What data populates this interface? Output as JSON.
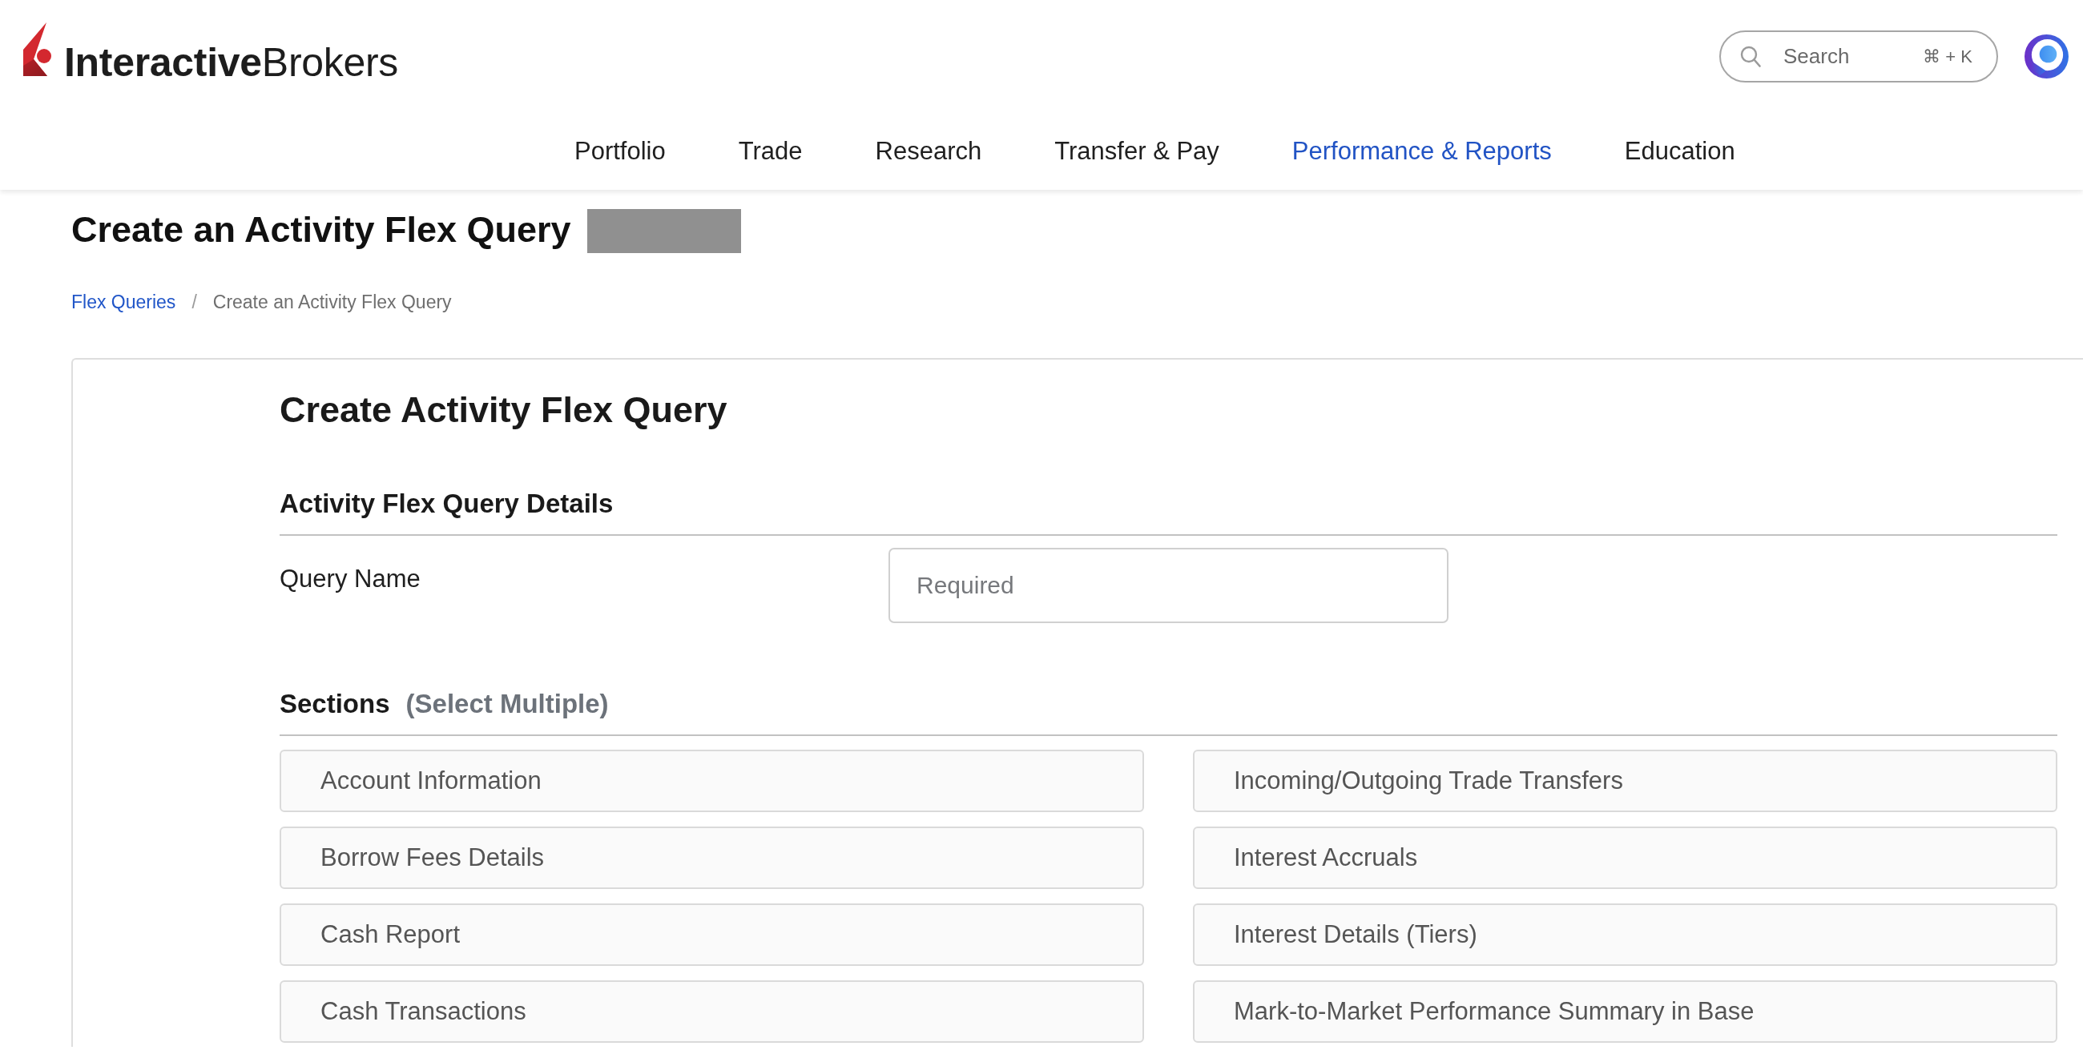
{
  "header": {
    "logo": "**Interactive**Brokers",
    "search": {
      "placeholder": "Search",
      "shortcut": "⌘ + K"
    }
  },
  "nav": [
    {
      "label": "Portfolio",
      "selected": false
    },
    {
      "label": "Trade",
      "selected": false
    },
    {
      "label": "Research",
      "selected": false
    },
    {
      "label": "Transfer & Pay",
      "selected": false
    },
    {
      "label": "Performance & Reports",
      "selected": true
    },
    {
      "label": "Education",
      "selected": false
    }
  ],
  "page": {
    "title": "Create an Activity Flex Query",
    "breadcrumb": {
      "separator": "/",
      "items": [
        {
          "label": "Flex Queries",
          "kind": "link"
        },
        {
          "label": "Create an Activity Flex Query",
          "kind": "current"
        }
      ]
    }
  },
  "form": {
    "title": "Create Activity Flex Query",
    "details": {
      "heading": "Activity Flex Query Details",
      "fields": [
        {
          "label": "Query Name",
          "placeholder": "Required"
        }
      ]
    },
    "sections": {
      "heading": "Sections",
      "hint": "(Select Multiple)",
      "columns": [
        {
          "items": [
            {
              "label": "Account Information",
              "selected": false
            },
            {
              "label": "Borrow Fees Details",
              "selected": false
            },
            {
              "label": "Cash Report",
              "selected": false
            },
            {
              "label": "Cash Transactions",
              "selected": false
            }
          ]
        },
        {
          "items": [
            {
              "label": "Incoming/Outgoing Trade Transfers",
              "selected": false
            },
            {
              "label": "Interest Accruals",
              "selected": false
            },
            {
              "label": "Interest Details (Tiers)",
              "selected": false
            },
            {
              "label": "Mark-to-Market Performance Summary in Base",
              "selected": false
            }
          ]
        }
      ]
    }
  }
}
